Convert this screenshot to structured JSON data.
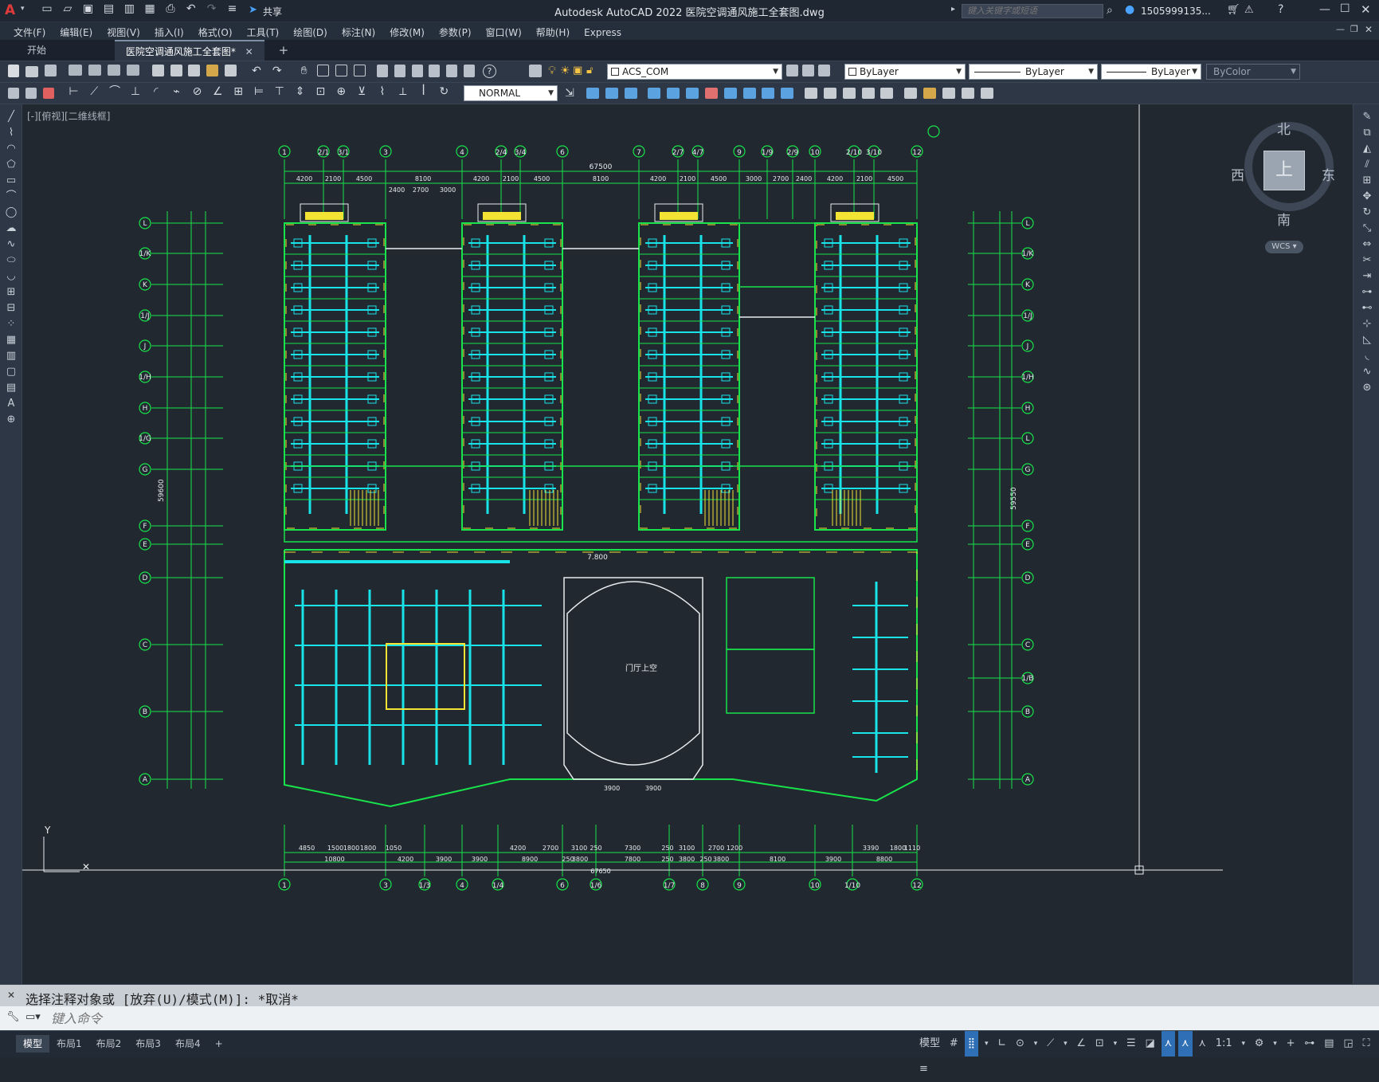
{
  "titlebar": {
    "title": "Autodesk AutoCAD 2022    医院空调通风施工全套图.dwg",
    "search_placeholder": "键入关键字或短语",
    "user": "1505999135...",
    "share": "共享"
  },
  "menu": [
    "文件(F)",
    "编辑(E)",
    "视图(V)",
    "插入(I)",
    "格式(O)",
    "工具(T)",
    "绘图(D)",
    "标注(N)",
    "修改(M)",
    "参数(P)",
    "窗口(W)",
    "帮助(H)",
    "Express"
  ],
  "tabs": {
    "start": "开始",
    "active_doc": "医院空调通风施工全套图*"
  },
  "toolbar": {
    "layer_current": "ACS_COM",
    "color": "ByLayer",
    "linetype": "ByLayer",
    "lineweight": "ByLayer",
    "plotstyle": "ByColor",
    "dimstyle": "NORMAL"
  },
  "viewport": {
    "label": "[-][俯视][二维线框]",
    "compass": {
      "north": "北",
      "south": "南",
      "east": "东",
      "west": "西",
      "top": "上"
    },
    "wcs": "WCS",
    "ucs_y": "Y"
  },
  "drawing": {
    "top_axes": [
      "1",
      "2/1",
      "3/1",
      "3",
      "4",
      "2/4",
      "3/4",
      "6",
      "7",
      "2/7",
      "4/7",
      "9",
      "1/9",
      "2/9",
      "10",
      "2/10",
      "3/10",
      "12"
    ],
    "bottom_axes": [
      "1",
      "3",
      "1/3",
      "4",
      "1/4",
      "6",
      "1/6",
      "1/7",
      "8",
      "9",
      "10",
      "1/10",
      "12"
    ],
    "left_axes": [
      "L",
      "1/K",
      "K",
      "1/J",
      "J",
      "1/H",
      "H",
      "1/G",
      "G",
      "F",
      "E",
      "D",
      "C",
      "B",
      "A"
    ],
    "right_axes": [
      "L",
      "1/K",
      "K",
      "1/J",
      "J",
      "1/H",
      "H",
      "L",
      "G",
      "F",
      "E",
      "D",
      "C",
      "1/B",
      "B",
      "A"
    ],
    "overall_dim": "67500",
    "top_dims": [
      "4200",
      "2100",
      "4500",
      "8100",
      "4200",
      "2100",
      "4500",
      "8100",
      "4200",
      "2100",
      "4500",
      "3000",
      "2700",
      "2400",
      "4200",
      "2100",
      "4500"
    ],
    "top_dims_2": [
      "2400",
      "2700",
      "3000"
    ],
    "bottom_dims_1": [
      "4850",
      "1500",
      "1800",
      "1800",
      "1050",
      "4200",
      "2700",
      "3100",
      "250",
      "7300",
      "250",
      "3100",
      "2700",
      "1200",
      "3390",
      "1800",
      "1110"
    ],
    "bottom_dims_2": [
      "10800",
      "4200",
      "3900",
      "3900",
      "8900",
      "250",
      "3800",
      "7800",
      "250",
      "3800",
      "250",
      "3800",
      "8100",
      "3900",
      "8800"
    ],
    "bottom_total": "67650",
    "left_total": "59600",
    "right_total": "59550",
    "lobby_label": "门厅上空",
    "elevation": "7.800",
    "center_dims": [
      "3900",
      "3900"
    ]
  },
  "command": {
    "history": "选择注释对象或 [放弃(U)/模式(M)]: *取消*",
    "placeholder": "键入命令"
  },
  "layouts": [
    "模型",
    "布局1",
    "布局2",
    "布局3",
    "布局4"
  ],
  "status": {
    "model": "模型",
    "scale": "1:1"
  }
}
